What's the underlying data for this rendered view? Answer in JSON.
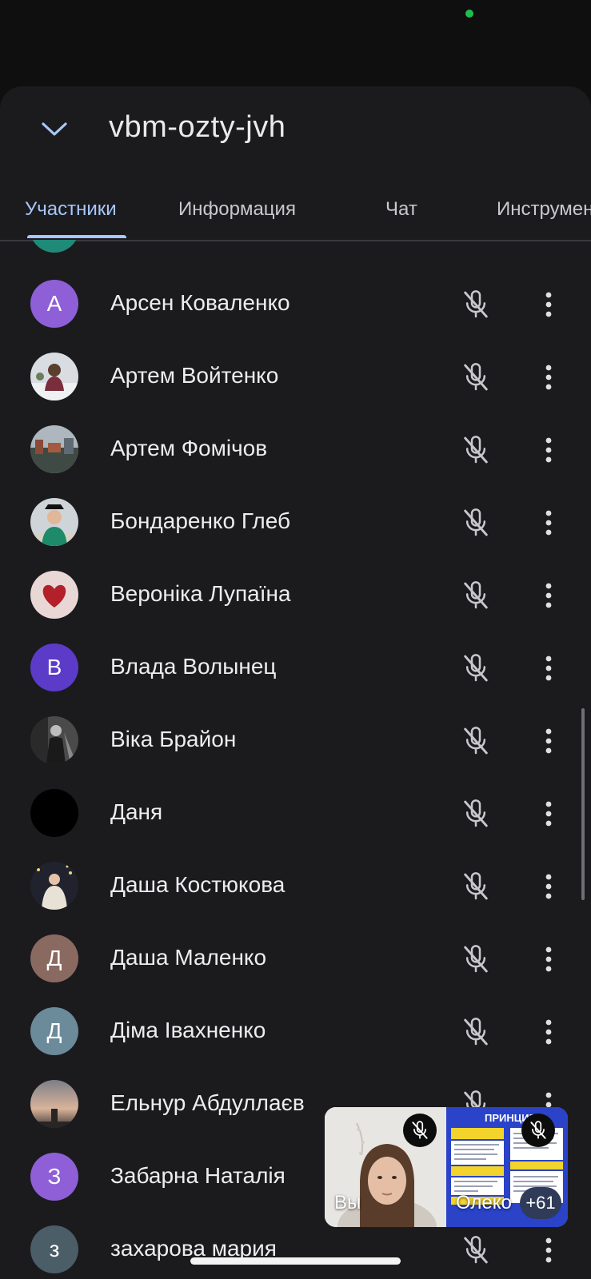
{
  "meeting": {
    "code": "vbm-ozty-jvh"
  },
  "tabs": [
    {
      "label": "Участники",
      "active": true
    },
    {
      "label": "Информация",
      "active": false
    },
    {
      "label": "Чат",
      "active": false
    },
    {
      "label": "Инструменты",
      "active": false
    }
  ],
  "participants": [
    {
      "name": "Арсен Коваленко",
      "initial": "А",
      "avatar_color": "#8e5fd6",
      "muted": true
    },
    {
      "name": "Артем Войтенко",
      "avatar": "photo",
      "muted": true
    },
    {
      "name": "Артем Фомічов",
      "avatar": "photo",
      "muted": true
    },
    {
      "name": "Бондаренко Глеб",
      "avatar": "photo",
      "muted": true
    },
    {
      "name": "Вероніка Лупаїна",
      "avatar": "photo",
      "muted": true
    },
    {
      "name": "Влада Волынец",
      "initial": "В",
      "avatar_color": "#5b3bc8",
      "muted": true
    },
    {
      "name": "Віка Брайон",
      "avatar": "photo",
      "muted": true
    },
    {
      "name": "Даня",
      "avatar": "photo",
      "muted": true
    },
    {
      "name": "Даша Костюкова",
      "avatar": "photo",
      "muted": true
    },
    {
      "name": "Даша Маленко",
      "initial": "Д",
      "avatar_color": "#8a6a60",
      "muted": true
    },
    {
      "name": "Діма Івахненко",
      "initial": "Д",
      "avatar_color": "#6b8a9a",
      "muted": true
    },
    {
      "name": "Ельнур Абдуллаєв",
      "avatar": "photo",
      "muted": true
    },
    {
      "name": "Забарна Наталія",
      "initial": "З",
      "avatar_color": "#8e5fd6",
      "muted": true
    },
    {
      "name": "захарова мария",
      "initial": "з",
      "avatar_color": "#4b5d66",
      "muted": true
    }
  ],
  "pip": {
    "self_label": "Вы",
    "other_label": "Олеко",
    "slide_title": "ПРИНЦИПИ",
    "more_count": "+61"
  },
  "colors": {
    "accent": "#a8c7fa",
    "sheet": "#1b1b1e",
    "background": "#0f0f10"
  }
}
